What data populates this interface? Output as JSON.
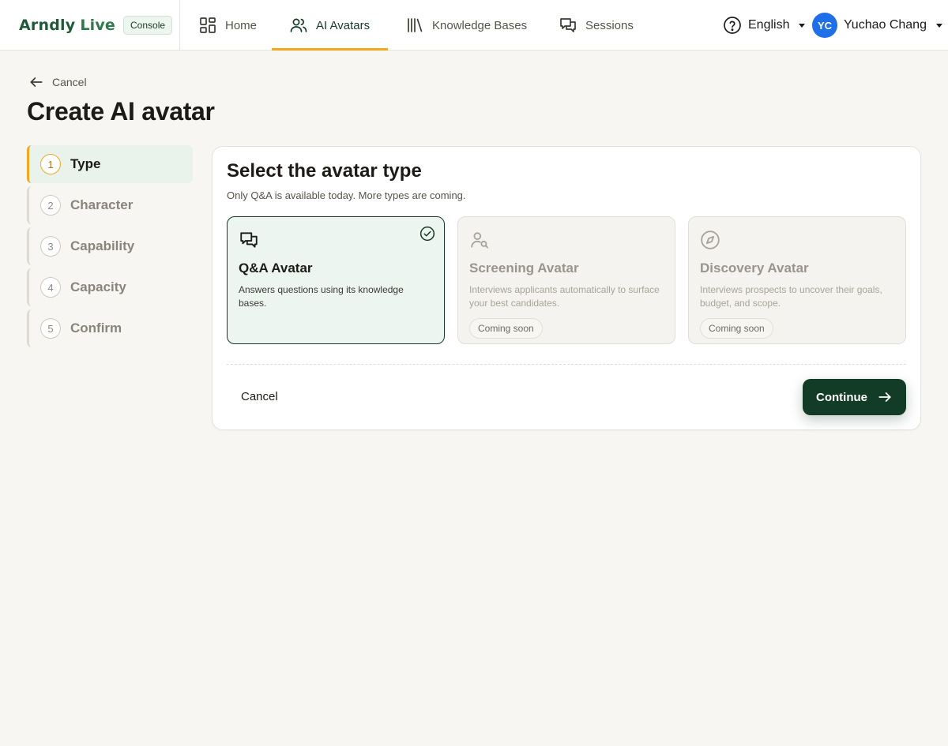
{
  "header": {
    "logo_text_main": "Arndly",
    "logo_text_live": "Live",
    "console_badge": "Console",
    "nav": [
      {
        "label": "Home",
        "icon": "home-grid-icon",
        "active": false
      },
      {
        "label": "AI Avatars",
        "icon": "users-icon",
        "active": true
      },
      {
        "label": "Knowledge Bases",
        "icon": "library-icon",
        "active": false
      },
      {
        "label": "Sessions",
        "icon": "chat-bubbles-icon",
        "active": false
      }
    ],
    "language": "English",
    "user": {
      "initials": "YC",
      "name": "Yuchao Chang"
    }
  },
  "page": {
    "back_label": "Cancel",
    "title": "Create AI avatar"
  },
  "steps": [
    {
      "num": "1",
      "label": "Type",
      "active": true
    },
    {
      "num": "2",
      "label": "Character",
      "active": false
    },
    {
      "num": "3",
      "label": "Capability",
      "active": false
    },
    {
      "num": "4",
      "label": "Capacity",
      "active": false
    },
    {
      "num": "5",
      "label": "Confirm",
      "active": false
    }
  ],
  "card": {
    "title": "Select the avatar type",
    "subtitle": "Only Q&A is available today. More types are coming.",
    "types": [
      {
        "name": "Q&A Avatar",
        "desc": "Answers questions using its knowledge bases.",
        "selected": true,
        "icon": "chat-bubbles-icon"
      },
      {
        "name": "Screening Avatar",
        "desc": "Interviews applicants automatically to surface your best candidates.",
        "badge": "Coming soon",
        "icon": "user-search-icon"
      },
      {
        "name": "Discovery Avatar",
        "desc": "Interviews prospects to uncover their goals, budget, and scope.",
        "badge": "Coming soon",
        "icon": "compass-icon"
      }
    ],
    "cancel_label": "Cancel",
    "continue_label": "Continue"
  },
  "colors": {
    "accent": "#f0a81f",
    "primary_dark": "#123c26",
    "selected_bg": "#edf5f0",
    "page_bg": "#f7f6f2",
    "avatar_blue": "#1e6fe8"
  }
}
